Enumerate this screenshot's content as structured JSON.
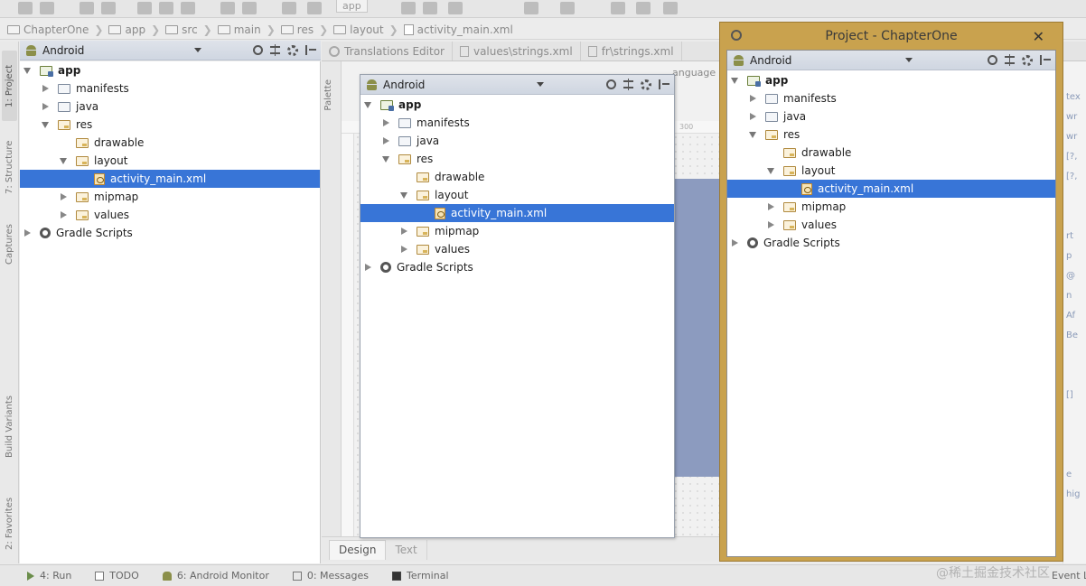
{
  "toolbar": {
    "run_config": "app"
  },
  "breadcrumb": [
    "ChapterOne",
    "app",
    "src",
    "main",
    "res",
    "layout",
    "activity_main.xml"
  ],
  "left_stripe": {
    "tabs": [
      "1: Project",
      "7: Structure",
      "Captures",
      "Build Variants",
      "2: Favorites"
    ]
  },
  "project_panel": {
    "view_mode": "Android",
    "tree": [
      {
        "label": "app",
        "icon": "module-folder-icon",
        "expanded": true,
        "depth": 0,
        "bold": true
      },
      {
        "label": "manifests",
        "icon": "folder-icon",
        "expanded": false,
        "depth": 1
      },
      {
        "label": "java",
        "icon": "folder-icon",
        "expanded": false,
        "depth": 1
      },
      {
        "label": "res",
        "icon": "res-folder-icon",
        "expanded": true,
        "depth": 1
      },
      {
        "label": "drawable",
        "icon": "res-folder-icon",
        "leaf": true,
        "depth": 2
      },
      {
        "label": "layout",
        "icon": "res-folder-icon",
        "expanded": true,
        "depth": 2
      },
      {
        "label": "activity_main.xml",
        "icon": "xml-file-icon",
        "leaf": true,
        "depth": 3,
        "selected": true
      },
      {
        "label": "mipmap",
        "icon": "res-folder-icon",
        "expanded": false,
        "depth": 2
      },
      {
        "label": "values",
        "icon": "res-folder-icon",
        "expanded": false,
        "depth": 2
      },
      {
        "label": "Gradle Scripts",
        "icon": "gradle-icon",
        "expanded": false,
        "depth": 0
      }
    ]
  },
  "editor_tabs": [
    "Translations Editor",
    "values\\strings.xml",
    "fr\\strings.xml"
  ],
  "designer": {
    "palette_label": "Palette",
    "language_fragment": "anguage",
    "ruler_mark": "300",
    "tabs": [
      "Design",
      "Text"
    ]
  },
  "floating_window": {
    "view_mode": "Android"
  },
  "yellow_window": {
    "title": "Project - ChapterOne",
    "view_mode": "Android"
  },
  "properties_fragment": [
    "tex",
    "wr",
    "wr",
    "[?,",
    "[?,",
    "rt",
    "p",
    "@",
    "n",
    "Af",
    "Be",
    "[]",
    "e",
    "hig"
  ],
  "status_bar": {
    "items": [
      "4: Run",
      "TODO",
      "6: Android Monitor",
      "0: Messages",
      "Terminal"
    ],
    "event_log": "Event L"
  },
  "watermark": "@稀土掘金技术社区",
  "colors": {
    "selection": "#3875d7",
    "yellow_frame": "#c9a24e",
    "header": "#d3d9e3"
  }
}
